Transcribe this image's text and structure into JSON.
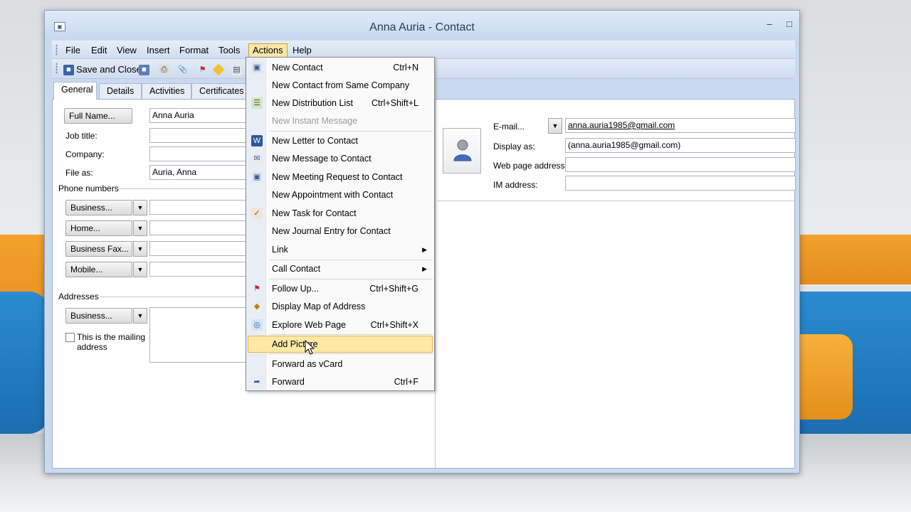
{
  "window": {
    "title": "Anna Auria - Contact"
  },
  "menubar": {
    "items": [
      "File",
      "Edit",
      "View",
      "Insert",
      "Format",
      "Tools",
      "Actions",
      "Help"
    ]
  },
  "toolbar": {
    "save_close_label": "Save and Close"
  },
  "tabs": [
    "General",
    "Details",
    "Activities",
    "Certificates"
  ],
  "general": {
    "full_name_button": "Full Name...",
    "full_name_value": "Anna Auria",
    "job_title_label": "Job title:",
    "company_label": "Company:",
    "file_as_label": "File as:",
    "file_as_value": "Auria, Anna",
    "phone_section": "Phone numbers",
    "phones": [
      "Business...",
      "Home...",
      "Business Fax...",
      "Mobile..."
    ],
    "addresses_section": "Addresses",
    "address_button": "Business...",
    "mailing_checkbox_label_1": "This is the mailing",
    "mailing_checkbox_label_2": "address",
    "email_label": "E-mail...",
    "email_value": "anna.auria1985@gmail.com",
    "display_as_label": "Display as:",
    "display_as_value": "(anna.auria1985@gmail.com)",
    "web_page_label": "Web page address:",
    "im_label": "IM address:"
  },
  "actions_menu": {
    "items": [
      {
        "label": "New Contact",
        "shortcut": "Ctrl+N"
      },
      {
        "label": "New Contact from Same Company",
        "shortcut": ""
      },
      {
        "label": "New Distribution List",
        "shortcut": "Ctrl+Shift+L"
      },
      {
        "label": "New Instant Message",
        "shortcut": "",
        "disabled": true
      },
      {
        "label": "New Letter to Contact",
        "shortcut": ""
      },
      {
        "label": "New Message to Contact",
        "shortcut": ""
      },
      {
        "label": "New Meeting Request to Contact",
        "shortcut": ""
      },
      {
        "label": "New Appointment with Contact",
        "shortcut": ""
      },
      {
        "label": "New Task for Contact",
        "shortcut": ""
      },
      {
        "label": "New Journal Entry for Contact",
        "shortcut": ""
      },
      {
        "label": "Link",
        "shortcut": "",
        "submenu": true
      },
      {
        "label": "Call Contact",
        "shortcut": "",
        "submenu": true
      },
      {
        "label": "Follow Up...",
        "shortcut": "Ctrl+Shift+G"
      },
      {
        "label": "Display Map of Address",
        "shortcut": ""
      },
      {
        "label": "Explore Web Page",
        "shortcut": "Ctrl+Shift+X"
      },
      {
        "label": "Add Picture",
        "shortcut": "",
        "highlighted": true
      },
      {
        "label": "Forward as vCard",
        "shortcut": ""
      },
      {
        "label": "Forward",
        "shortcut": "Ctrl+F"
      }
    ]
  },
  "colors": {
    "window_frame": "#c9daf0",
    "menu_highlight": "#fde8a6",
    "menu_highlight_border": "#e2b44a",
    "disabled_text": "#9a9a9a"
  }
}
